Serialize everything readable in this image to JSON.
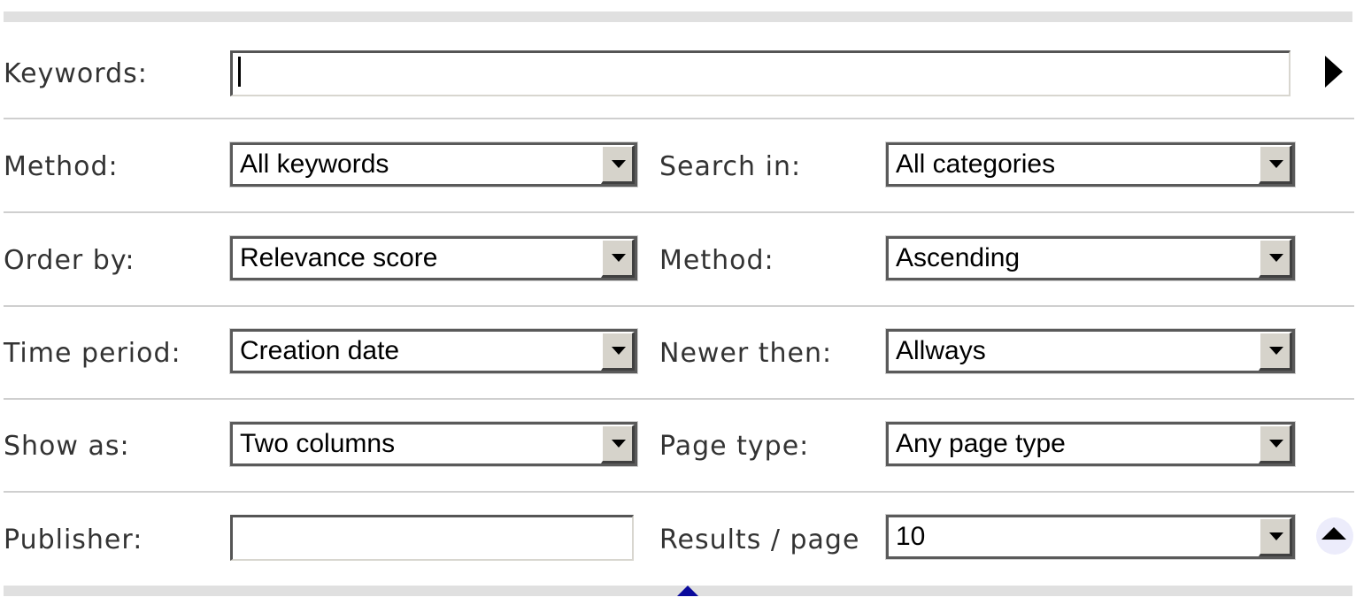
{
  "keywords": {
    "label": "Keywords:",
    "value": ""
  },
  "rows": [
    {
      "left_label": "Method:",
      "left_value": "All keywords",
      "right_label": "Search in:",
      "right_value": "All categories"
    },
    {
      "left_label": "Order by:",
      "left_value": "Relevance score",
      "right_label": "Method:",
      "right_value": "Ascending"
    },
    {
      "left_label": "Time period:",
      "left_value": "Creation date",
      "right_label": "Newer then:",
      "right_value": "Allways"
    },
    {
      "left_label": "Show as:",
      "left_value": "Two columns",
      "right_label": "Page type:",
      "right_value": "Any page type"
    }
  ],
  "publisher": {
    "label": "Publisher:",
    "value": ""
  },
  "results_per_page": {
    "label": "Results / page",
    "value": "10"
  },
  "icons": {
    "submit": "play-triangle-icon",
    "collapse": "triangle-up-icon",
    "resize": "triangle-up-icon"
  },
  "colors": {
    "separator": "#cfcfcf",
    "bar": "#e0e0e0",
    "collapse_bg": "#ececfb",
    "handle": "#0a0a9c"
  }
}
